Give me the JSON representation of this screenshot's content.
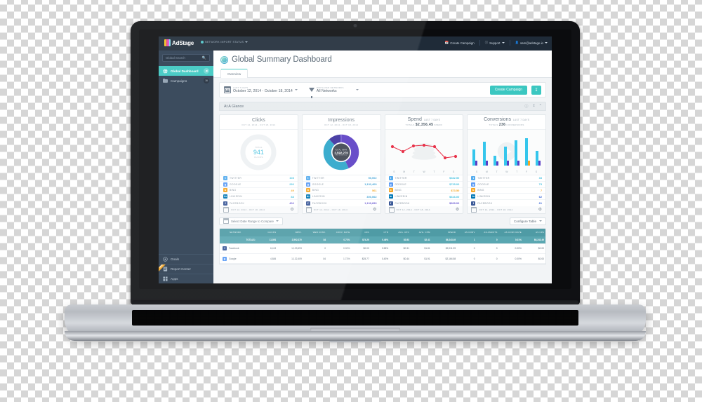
{
  "app": {
    "brand": "AdStage",
    "network_import_status": "NETWORK IMPORT STATUS",
    "topnav": [
      {
        "label": "Create Campaign",
        "icon": "calendar-plus-icon"
      },
      {
        "label": "Support",
        "icon": "help-circle-icon"
      },
      {
        "label": "sam@adstage.io",
        "icon": "user-icon"
      }
    ]
  },
  "sidebar": {
    "search_placeholder": "Global Search",
    "items": [
      {
        "label": "Global Dashboard",
        "icon": "globe-icon",
        "active": true,
        "badge": "◀"
      },
      {
        "label": "Campaigns",
        "icon": "folder-icon",
        "active": false,
        "badge": "16"
      }
    ],
    "bottom_items": [
      {
        "label": "Goals",
        "icon": "target-icon",
        "flag": ""
      },
      {
        "label": "Report Center",
        "icon": "report-icon",
        "flag": "NEW"
      },
      {
        "label": "Apps",
        "icon": "grid-icon",
        "flag": ""
      }
    ]
  },
  "page": {
    "title": "Global Summary Dashboard",
    "tabs": [
      {
        "label": "Overview",
        "active": true
      }
    ]
  },
  "filters": {
    "date": {
      "label": "LAST 7 DAYS",
      "value": "October 12, 2014 - October 18, 2014",
      "icon": "calendar-icon"
    },
    "networks": {
      "label": "DISPLAYED NETWORKS",
      "value": "All Networks",
      "icon": "funnel-icon"
    },
    "create_campaign": "Create Campaign",
    "download_icon": "download-icon"
  },
  "glance": {
    "title": "At A Glance",
    "icons": [
      "info-icon",
      "download-icon",
      "collapse-icon"
    ]
  },
  "cards": [
    {
      "title": "Clicks",
      "period": "",
      "subtitle": "OCT 12, 2014 - OCT 18, 2014",
      "viz": "ring",
      "center": {
        "top": "TOTAL",
        "value": "941",
        "bottom": "CLICKS"
      },
      "rows": [
        {
          "network": "TWITTER",
          "icon": "twitter-icon",
          "color": "#55acee",
          "value": "108",
          "value_color": "#49c2e0"
        },
        {
          "network": "GOOGLE",
          "icon": "google-icon",
          "color": "#4285f4",
          "value": "290",
          "value_color": "#49c2e0"
        },
        {
          "network": "BING",
          "icon": "bing-icon",
          "color": "#f5a623",
          "value": "49",
          "value_color": "#f5a623"
        },
        {
          "network": "LINKEDIN",
          "icon": "linkedin-icon",
          "color": "#0077b5",
          "value": "88",
          "value_color": "#49c2e0"
        },
        {
          "network": "FACEBOOK",
          "icon": "facebook-icon",
          "color": "#3b5998",
          "value": "406",
          "value_color": "#6b5bd2"
        }
      ],
      "footer": "OCT 12, 2014 - OCT 18, 2014"
    },
    {
      "title": "Impressions",
      "period": "",
      "subtitle": "OCT 12, 2014 - OCT 18, 2014",
      "viz": "donut",
      "center": {
        "top": "TOTAL IMPR.",
        "value": "2,592,270",
        "bottom": "IMPRESSIONS"
      },
      "rows": [
        {
          "network": "TWITTER",
          "icon": "twitter-icon",
          "color": "#55acee",
          "value": "50,002",
          "value_color": "#3aa0d6"
        },
        {
          "network": "GOOGLE",
          "icon": "google-icon",
          "color": "#4285f4",
          "value": "1,132,409",
          "value_color": "#3aa0d6"
        },
        {
          "network": "BING",
          "icon": "bing-icon",
          "color": "#f5a623",
          "value": "561",
          "value_color": "#f5a623"
        },
        {
          "network": "LINKEDIN",
          "icon": "linkedin-icon",
          "color": "#0077b5",
          "value": "300,002",
          "value_color": "#3aa0d6"
        },
        {
          "network": "FACEBOOK",
          "icon": "facebook-icon",
          "color": "#3b5998",
          "value": "1,109,693",
          "value_color": "#6b5bd2"
        }
      ],
      "footer": "OCT 12, 2014 - OCT 18, 2014"
    },
    {
      "title": "Spend",
      "period": "LAST 7 DAYS",
      "subtitle_prefix": "TOTALS",
      "subtitle_value": "$2,356.45",
      "subtitle_suffix": "SPEND",
      "viz": "line",
      "rows": [
        {
          "network": "TWITTER",
          "icon": "twitter-icon",
          "color": "#55acee",
          "value": "$332.50",
          "value_color": "#49c2e0"
        },
        {
          "network": "GOOGLE",
          "icon": "google-icon",
          "color": "#4285f4",
          "value": "$725.00",
          "value_color": "#49c2e0"
        },
        {
          "network": "BING",
          "icon": "bing-icon",
          "color": "#f5a623",
          "value": "$73.50",
          "value_color": "#f5a623"
        },
        {
          "network": "LINKEDIN",
          "icon": "linkedin-icon",
          "color": "#0077b5",
          "value": "$616.00",
          "value_color": "#49c2e0"
        },
        {
          "network": "FACEBOOK",
          "icon": "facebook-icon",
          "color": "#3b5998",
          "value": "$609.00",
          "value_color": "#6b5bd2"
        }
      ],
      "footer": "OCT 12, 2014 - OCT 18, 2014"
    },
    {
      "title": "Conversions",
      "period": "LAST 7 DAYS",
      "subtitle_prefix": "TOTALS",
      "subtitle_value": "236",
      "subtitle_suffix": "CONVERSIONS",
      "viz": "bar",
      "rows": [
        {
          "network": "TWITTER",
          "icon": "twitter-icon",
          "color": "#55acee",
          "value": "33",
          "value_color": "#49c2e0"
        },
        {
          "network": "GOOGLE",
          "icon": "google-icon",
          "color": "#4285f4",
          "value": "73",
          "value_color": "#49c2e0"
        },
        {
          "network": "BING",
          "icon": "bing-icon",
          "color": "#f5a623",
          "value": "7",
          "value_color": "#f5a623"
        },
        {
          "network": "LINKEDIN",
          "icon": "linkedin-icon",
          "color": "#0077b5",
          "value": "62",
          "value_color": "#3f6bd8"
        },
        {
          "network": "FACEBOOK",
          "icon": "facebook-icon",
          "color": "#3b5998",
          "value": "61",
          "value_color": "#3f6bd8"
        }
      ],
      "footer": "OCT 12, 2014 - OCT 18, 2014"
    }
  ],
  "chart_data": [
    {
      "type": "pie",
      "title": "Clicks",
      "subtitle": "OCT 12, 2014 - OCT 18, 2014",
      "labels": [
        "TWITTER",
        "GOOGLE",
        "BING",
        "LINKEDIN",
        "FACEBOOK"
      ],
      "values": [
        108,
        290,
        49,
        88,
        406
      ],
      "total": 941,
      "total_label": "TOTAL CLICKS",
      "legend": "below"
    },
    {
      "type": "pie",
      "title": "Impressions",
      "subtitle": "OCT 12, 2014 - OCT 18, 2014",
      "labels": [
        "TWITTER",
        "GOOGLE",
        "BING",
        "LINKEDIN",
        "FACEBOOK"
      ],
      "values": [
        50002,
        1132409,
        561,
        300002,
        1109693
      ],
      "total": 2592270,
      "total_label": "TOTAL IMPR. IMPRESSIONS",
      "colors": [
        "#35b3d6",
        "#5b3ec4",
        "#f5a623",
        "#2aa5c9",
        "#6b4fd8"
      ],
      "legend": "below"
    },
    {
      "type": "line",
      "title": "Spend",
      "subtitle": "TOTALS $2,356.45 SPEND",
      "categories": [
        "S",
        "M",
        "T",
        "W",
        "T",
        "F",
        "S"
      ],
      "values": [
        392,
        349,
        397,
        399,
        392,
        255,
        263
      ],
      "ylabel": "Spend ($)",
      "grid": false,
      "color": "#e8334a"
    },
    {
      "type": "bar",
      "title": "Conversions",
      "subtitle": "TOTALS 236 CONVERSIONS",
      "categories": [
        "S",
        "M",
        "T",
        "W",
        "T",
        "F",
        "S"
      ],
      "series": [
        {
          "name": "Conversions",
          "values": [
            28,
            42,
            17,
            33,
            44,
            50,
            25
          ],
          "color": "#35c6ec"
        },
        {
          "name": "Assisted",
          "values": [
            9,
            9,
            7,
            8,
            9,
            8,
            9
          ],
          "color": "#5b3ec4"
        }
      ],
      "ylabel": "Conversions",
      "grid": false
    }
  ],
  "compare": {
    "label": "Select Date Range to Compare",
    "icon": "calendar-icon",
    "configure_label": "Configure Table"
  },
  "table": {
    "columns": [
      "NETWORK",
      "CLICKS",
      "IMPR.",
      "WEB CONV.",
      "CONV. RATE",
      "CPA",
      "CTR",
      "AVG. CPC",
      "AVG. CPM",
      "SPEND",
      "AS CONV",
      "AS ASSISTS",
      "AS CONV RATE",
      "AS CPA"
    ],
    "totals_label": "TOTALS:",
    "totals": [
      "11,891",
      "2,592,270",
      "84",
      "0.71%",
      "$74.20",
      "0.46%",
      "$0.53",
      "$2.41",
      "$6,243.49",
      "1",
      "0",
      "0.01%",
      "$6,243.49"
    ],
    "rows": [
      {
        "network": "Facebook",
        "icon": "facebook-icon",
        "color": "#3b5998",
        "cells": [
          "6,413",
          "1,109,693",
          "0",
          "0.00%",
          "$0.00",
          "0.58%",
          "$0.31",
          "$1.81",
          "$2,011.99",
          "0",
          "0",
          "0.00%",
          "$0.00"
        ]
      },
      {
        "network": "Google",
        "icon": "google-icon",
        "color": "#4285f4",
        "cells": [
          "4,884",
          "1,132,409",
          "84",
          "1.72%",
          "$25.77",
          "0.43%",
          "$0.44",
          "$1.91",
          "$2,164.58",
          "0",
          "0",
          "0.00%",
          "$0.00"
        ]
      }
    ]
  },
  "colors": {
    "brand_teal": "#3bc7c1",
    "sidebar": "#2a3b4f",
    "topbar": "#1f2b38",
    "table_header": "#4f9ba5"
  }
}
